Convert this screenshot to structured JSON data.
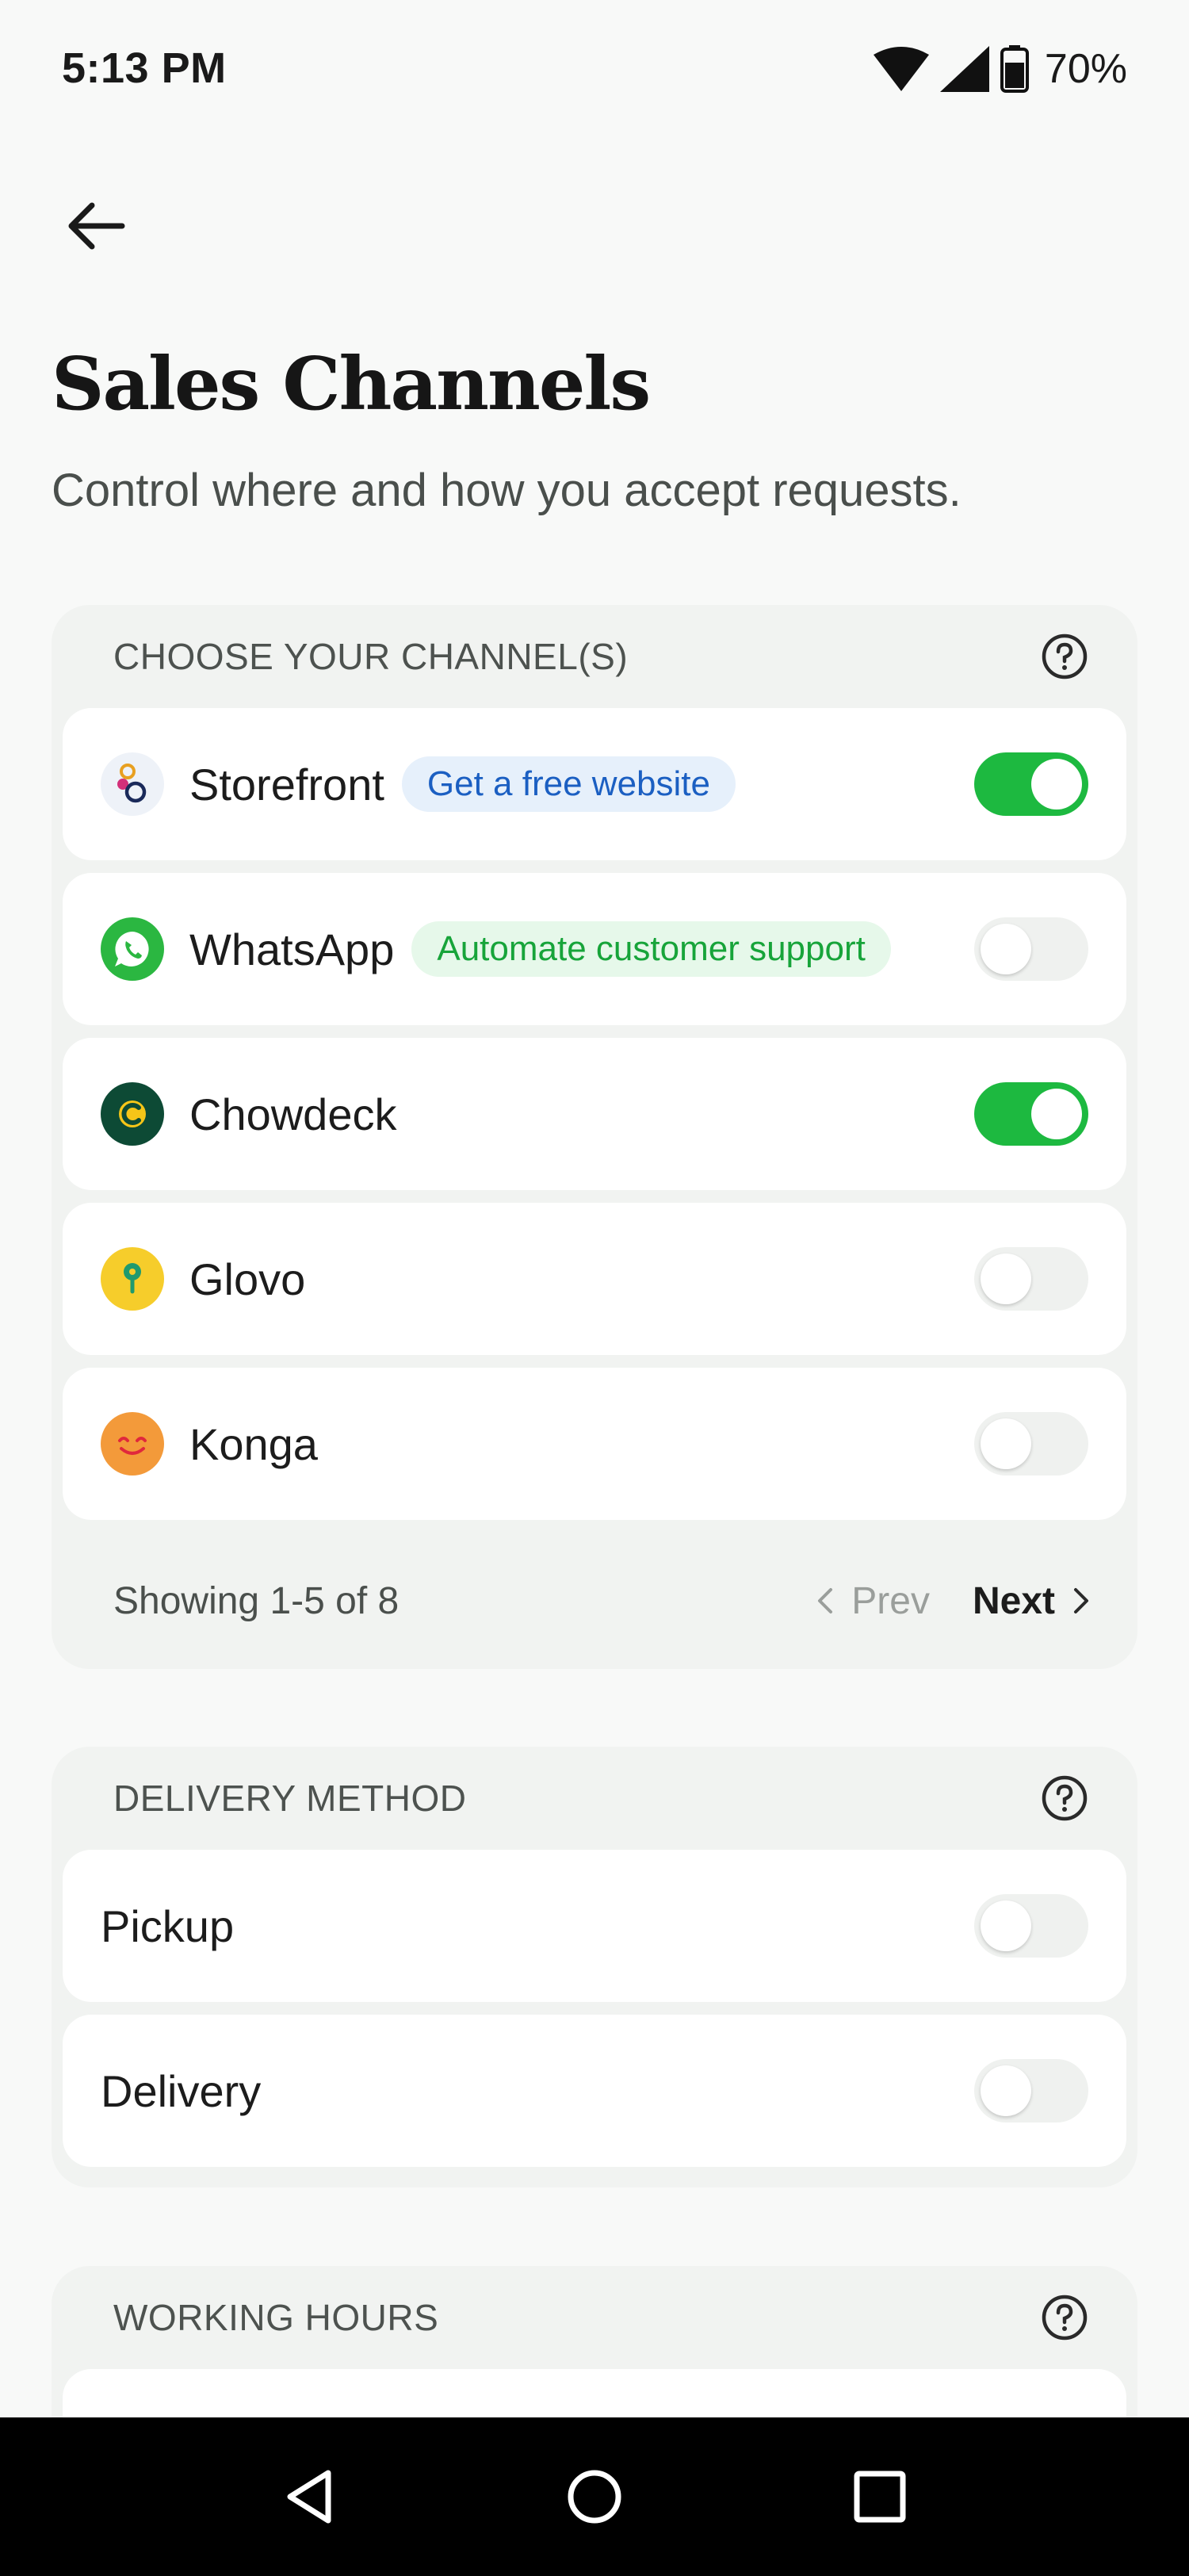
{
  "status_bar": {
    "time": "5:13 PM",
    "battery": "70%",
    "icons": [
      "wifi-icon",
      "signal-icon",
      "battery-icon"
    ]
  },
  "header": {
    "back_icon": "arrow-left-icon",
    "title": "Sales Channels",
    "subtitle": "Control where and how you accept requests."
  },
  "channels": {
    "title": "CHOOSE YOUR CHANNEL(S)",
    "items": [
      {
        "label": "Storefront",
        "badge": "Get a free website",
        "enabled": true
      },
      {
        "label": "WhatsApp",
        "badge": "Automate customer support",
        "enabled": false
      },
      {
        "label": "Chowdeck",
        "enabled": true
      },
      {
        "label": "Glovo",
        "enabled": false
      },
      {
        "label": "Konga",
        "enabled": false
      }
    ],
    "pagination": {
      "info": "Showing 1-5 of 8",
      "prev": "Prev",
      "next": "Next"
    }
  },
  "delivery": {
    "title": "DELIVERY METHOD",
    "items": [
      {
        "label": "Pickup",
        "enabled": false
      },
      {
        "label": "Delivery",
        "enabled": false
      }
    ]
  },
  "working_hours": {
    "title": "WORKING HOURS"
  },
  "colors": {
    "toggle_on": "#1db940",
    "badge_blue_text": "#1b5fc2",
    "badge_green_text": "#17a43a",
    "background": "#f8f9f8"
  },
  "nav_bar": [
    "back-triangle-icon",
    "home-circle-icon",
    "recents-square-icon"
  ]
}
